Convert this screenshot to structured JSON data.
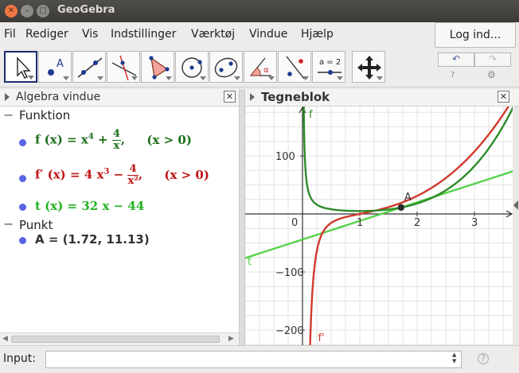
{
  "window": {
    "title": "GeoGebra"
  },
  "menu": {
    "items": [
      "Fil",
      "Rediger",
      "Vis",
      "Indstillinger",
      "Værktøj",
      "Vindue",
      "Hjælp"
    ],
    "login_label": "Log ind..."
  },
  "toolbar": {
    "tools": [
      "move-tool",
      "point-tool",
      "line-tool",
      "perpendicular-line-tool",
      "polygon-tool",
      "circle-tool",
      "conic-tool",
      "angle-tool",
      "reflect-tool",
      "slider-tool",
      "move-view-tool"
    ],
    "slider_label": "a = 2",
    "point_label": "A",
    "angle_label": "α"
  },
  "algebra": {
    "title": "Algebra vindue",
    "groups": [
      {
        "label": "Funktion",
        "items": [
          {
            "lhs": "f (x)",
            "eq": "=",
            "base": "x",
            "exp": "4",
            "op": "+",
            "num": "4",
            "den": "x",
            "tail": ",",
            "cond": "(x > 0)",
            "color": "#1c6e19"
          },
          {
            "lhs": "f′ (x)",
            "eq": "=",
            "base": "4 x",
            "exp": "3",
            "op": "−",
            "num": "4",
            "den": "x²",
            "tail": ",",
            "cond": "(x > 0)",
            "color": "#c01515"
          },
          {
            "lhs": "t (x)",
            "eq": "=",
            "rhs": "32 x − 44",
            "color": "#22b322"
          }
        ]
      },
      {
        "label": "Punkt",
        "items": [
          {
            "text": "A = (1.72,  11.13)",
            "color": "#333333"
          }
        ]
      }
    ]
  },
  "graphics": {
    "title": "Tegneblok",
    "x_ticks": [
      "0",
      "1",
      "2",
      "3"
    ],
    "y_ticks": [
      "100",
      "−100",
      "−200"
    ],
    "labels": {
      "f": "f",
      "fprime": "f'",
      "t": "t",
      "A": "A"
    }
  },
  "input": {
    "label": "Input:",
    "value": ""
  },
  "colors": {
    "f": "#2e8b2a",
    "fprime": "#d03a2c",
    "t": "#55d24a",
    "point": "#2b2b2b",
    "axis": "#333333",
    "grid": "#e3e3e3"
  },
  "icons": {
    "undo": "↶",
    "redo": "↷",
    "help": "?",
    "gear": "⚙",
    "close": "✕"
  }
}
